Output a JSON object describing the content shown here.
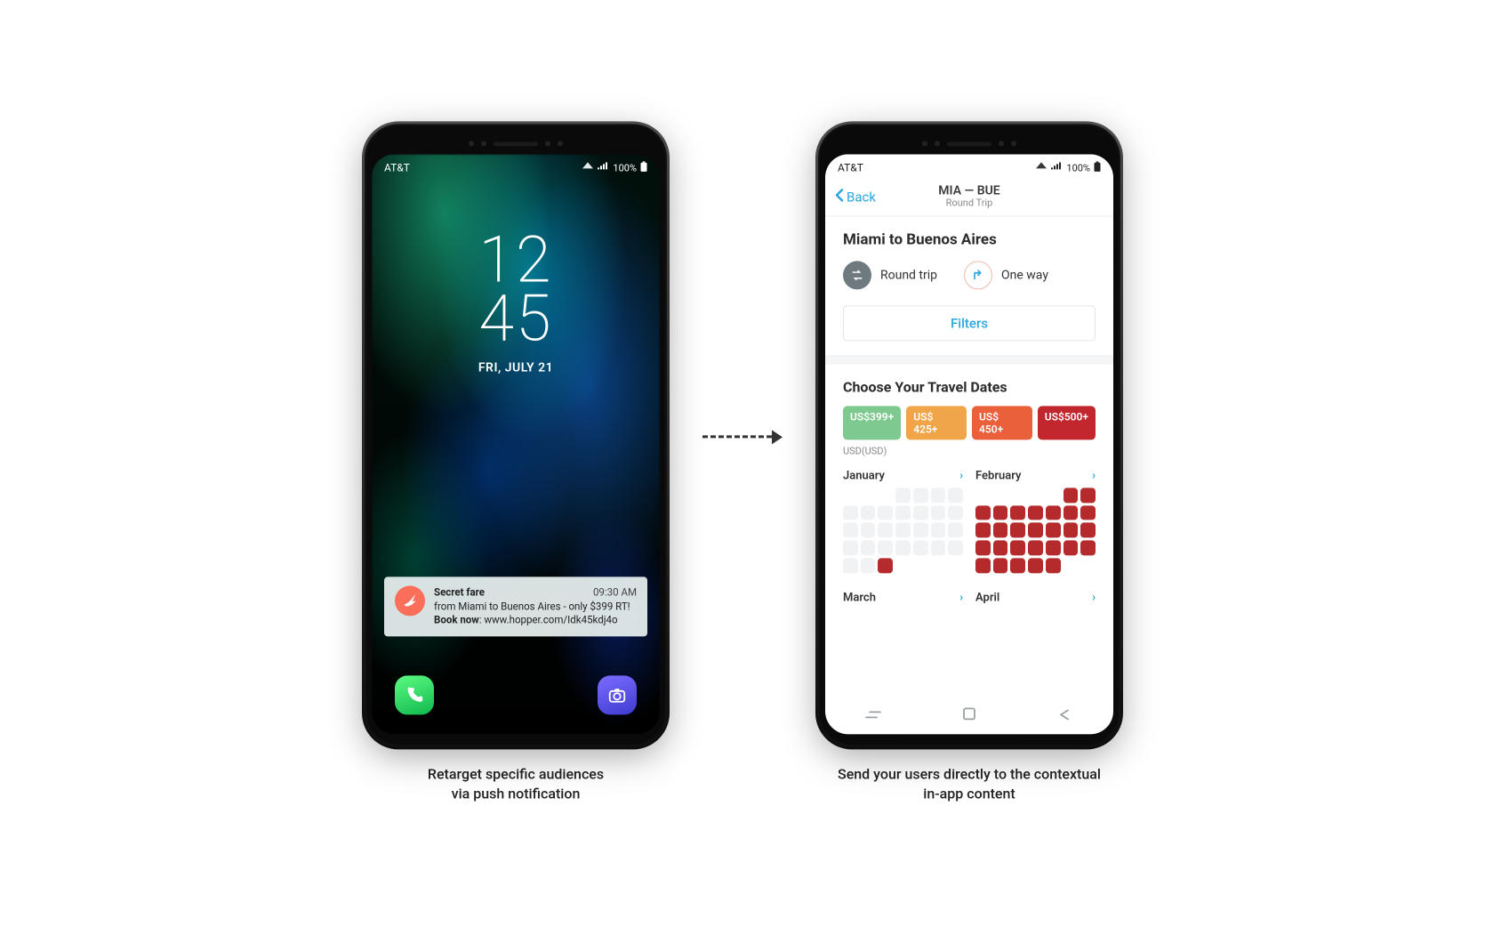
{
  "status": {
    "carrier": "AT&T",
    "battery": "100%"
  },
  "lock": {
    "clock_top": "12",
    "clock_bottom": "45",
    "date": "FRI, JULY 21"
  },
  "notification": {
    "title": "Secret fare",
    "time": "09:30 AM",
    "line2": "from Miami to Buenos Aires - only $399 RT!",
    "line3_bold": "Book now",
    "line3_rest": ": www.hopper.com/Idk45kdj4o"
  },
  "app": {
    "back": "Back",
    "nav_title": "MIA — BUE",
    "nav_sub": "Round Trip",
    "route": "Miami to Buenos Aires",
    "trip_round": "Round trip",
    "trip_oneway": "One way",
    "filters": "Filters",
    "dates_title": "Choose Your Travel Dates",
    "chips": {
      "c1": "US$399+",
      "c2": "US$ 425+",
      "c3": "US$ 450+",
      "c4": "US$500+"
    },
    "currency_note": "USD(USD)",
    "months": {
      "jan": "January",
      "feb": "February",
      "mar": "March",
      "apr": "April"
    }
  },
  "captions": {
    "left_l1": "Retarget specific audiences",
    "left_l2": "via push notification",
    "right_l1": "Send your users directly to the contextual",
    "right_l2": "in-app content"
  }
}
